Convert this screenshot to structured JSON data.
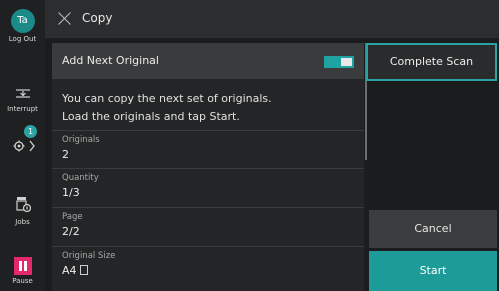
{
  "rail": {
    "avatar_initials": "Ta",
    "logout_label": "Log Out",
    "interrupt_label": "Interrupt",
    "settings_badge": "1",
    "jobs_label": "Jobs",
    "pause_label": "Pause"
  },
  "header": {
    "title": "Copy"
  },
  "panel": {
    "toggle_label": "Add Next Original",
    "toggle_on": true,
    "message_line1": "You can copy the next set of originals.",
    "message_line2": "Load the originals and tap Start.",
    "fields": [
      {
        "label": "Originals",
        "value": "2"
      },
      {
        "label": "Quantity",
        "value": "1/3"
      },
      {
        "label": "Page",
        "value": "2/2"
      },
      {
        "label": "Original Size",
        "value": "A4"
      }
    ]
  },
  "buttons": {
    "complete_scan": "Complete Scan",
    "cancel": "Cancel",
    "start": "Start"
  },
  "colors": {
    "accent": "#1c9b98",
    "pause": "#e4286a",
    "background": "#1b1c1d"
  }
}
